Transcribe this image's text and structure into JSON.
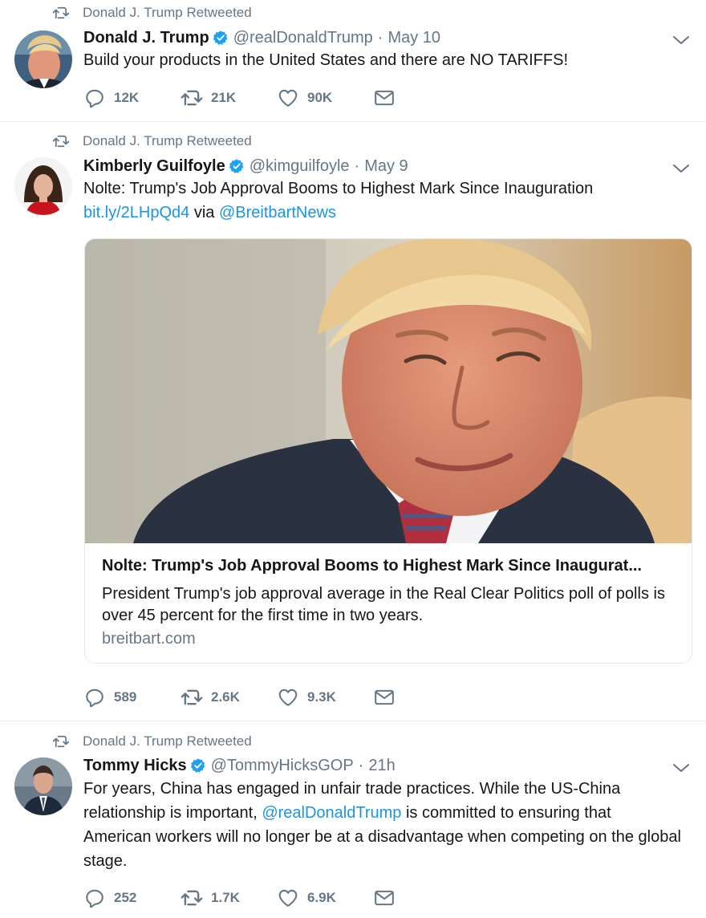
{
  "icons": {
    "retweet_indicator": "retweet-icon",
    "verified": "verified-badge-icon",
    "more": "chevron-down-icon",
    "reply": "reply-icon",
    "retweet": "retweet-icon",
    "like": "heart-icon",
    "message": "envelope-icon"
  },
  "colors": {
    "link": "#1b95e0",
    "verified": "#1da1f2",
    "muted": "#657786",
    "divider": "#e6ecf0"
  },
  "tweets": [
    {
      "retweeted_by": "Donald J. Trump Retweeted",
      "name": "Donald J. Trump",
      "handle": "@realDonaldTrump",
      "separator": "·",
      "date": "May 10",
      "text": "Build your products in the United States and there are NO TARIFFS!",
      "stats": {
        "replies": "12K",
        "retweets": "21K",
        "likes": "90K"
      }
    },
    {
      "retweeted_by": "Donald J. Trump Retweeted",
      "name": "Kimberly Guilfoyle",
      "handle": "@kimguilfoyle",
      "separator": "·",
      "date": "May 9",
      "text": "Nolte: Trump's Job Approval Booms to Highest Mark Since Inauguration",
      "link_url": "bit.ly/2LHpQd4",
      "via": " via ",
      "mention": "@BreitbartNews",
      "card": {
        "image_alt": "Donald Trump smiling, wearing dark suit and striped tie",
        "title": "Nolte: Trump's Job Approval Booms to Highest Mark Since Inaugurat...",
        "description": "President Trump's job approval average in the Real Clear Politics poll of polls is over 45 percent for the first time in two years.",
        "domain": "breitbart.com"
      },
      "stats": {
        "replies": "589",
        "retweets": "2.6K",
        "likes": "9.3K"
      }
    },
    {
      "retweeted_by": "Donald J. Trump Retweeted",
      "name": "Tommy Hicks",
      "handle": "@TommyHicksGOP",
      "separator": "·",
      "date": "21h",
      "text_before": "For years, China has engaged in unfair trade practices. While the US-China relationship is important, ",
      "mention": "@realDonaldTrump",
      "text_after": " is committed to ensuring that American workers will no longer be at a disadvantage when competing on the global stage.",
      "stats": {
        "replies": "252",
        "retweets": "1.7K",
        "likes": "6.9K"
      }
    }
  ]
}
